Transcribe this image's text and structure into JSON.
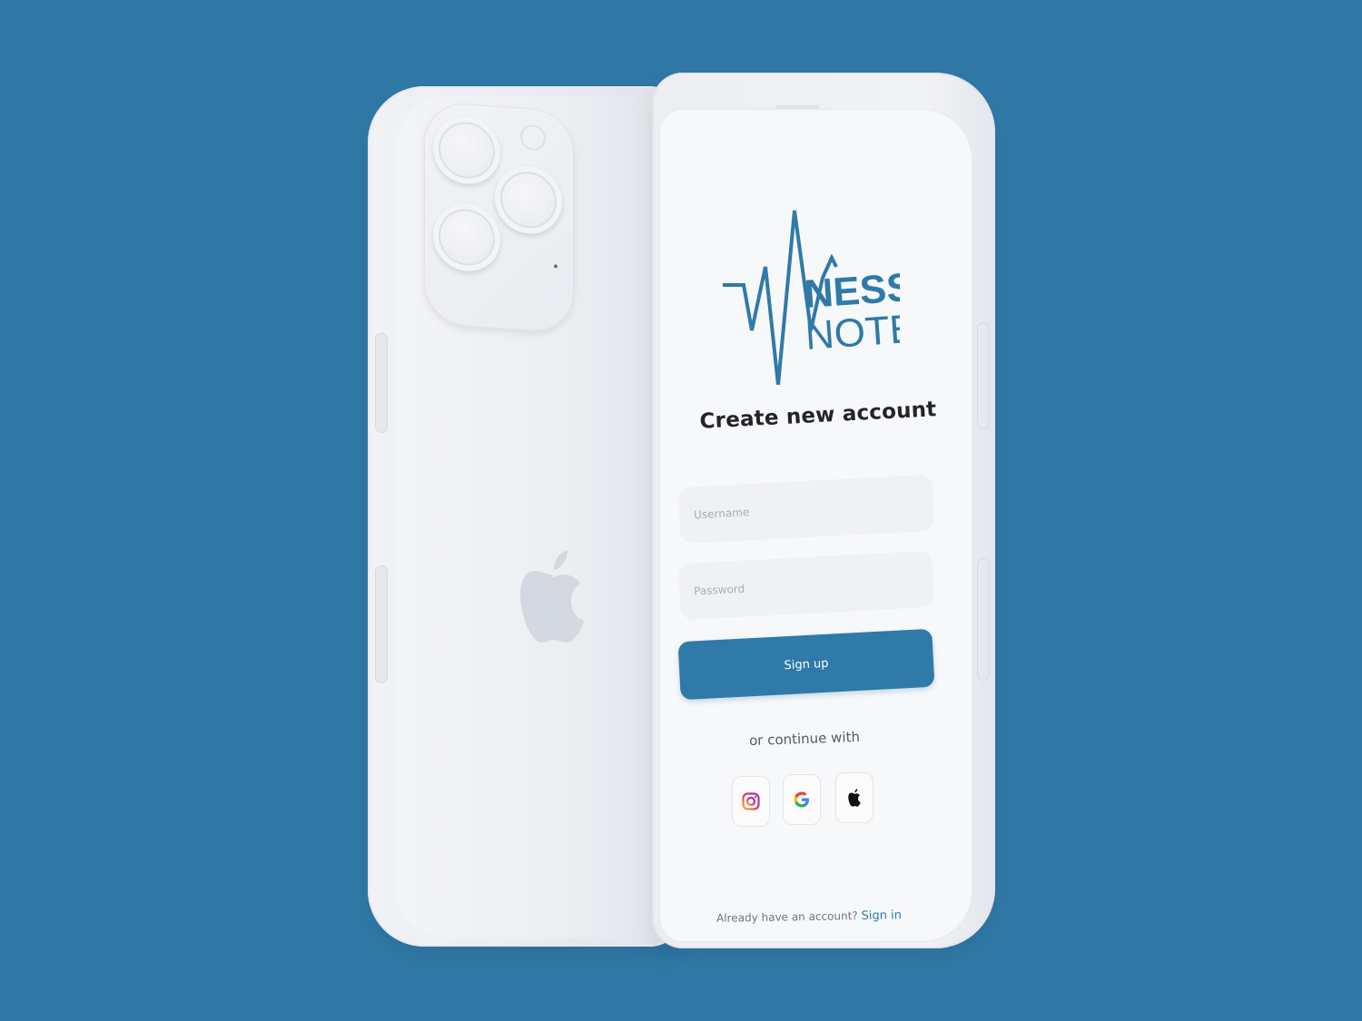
{
  "brand": {
    "logo_line1": "NESS",
    "logo_line2": "NOTES",
    "color": "#2f7aa8"
  },
  "signup": {
    "title": "Create new account",
    "username_placeholder": "Username",
    "password_placeholder": "Password",
    "button_label": "Sign up",
    "continue_text": "or continue with",
    "social": [
      {
        "name": "instagram-icon"
      },
      {
        "name": "google-icon"
      },
      {
        "name": "apple-icon"
      }
    ],
    "footer_text": "Already have an account?",
    "footer_link": "Sign in"
  },
  "colors": {
    "background": "#3079a7",
    "accent": "#2f7aa8"
  }
}
